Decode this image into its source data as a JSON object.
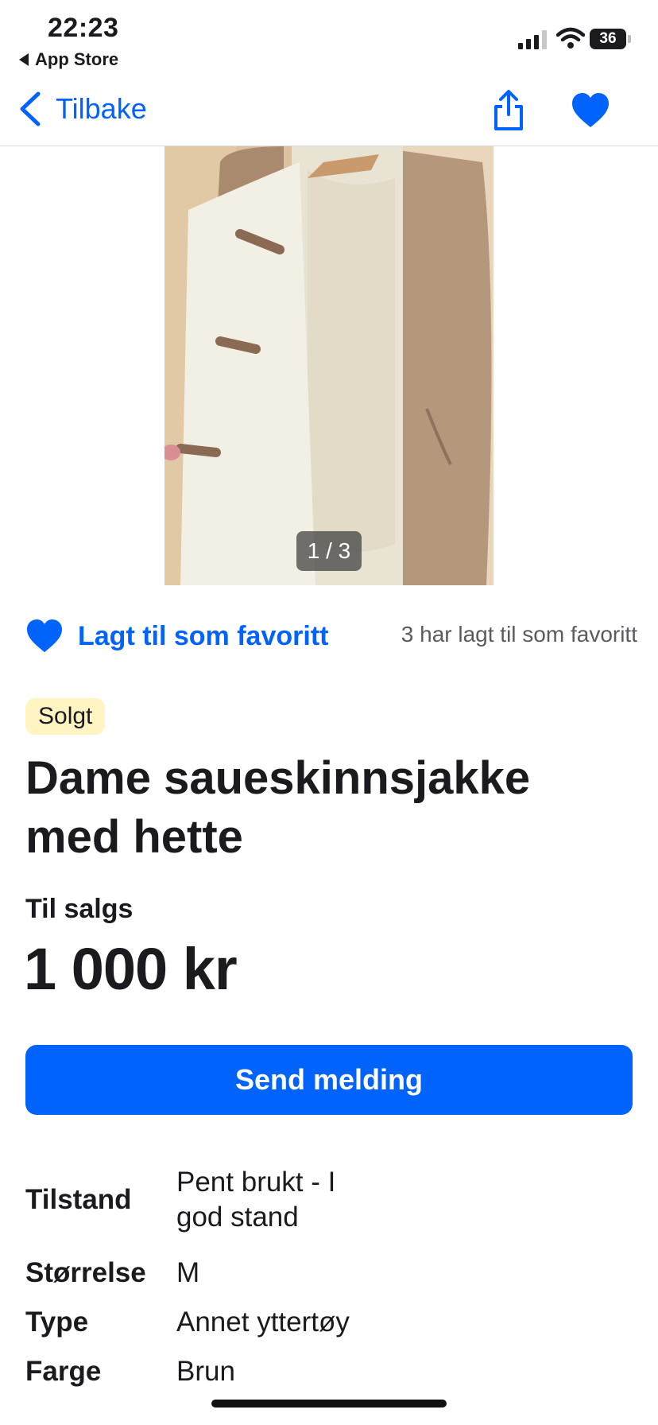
{
  "status_bar": {
    "time": "22:23",
    "back_app": "App Store",
    "battery": "36"
  },
  "nav": {
    "back_label": "Tilbake",
    "share_icon": "share-icon",
    "favorite_icon": "heart-icon"
  },
  "gallery": {
    "counter": "1 / 3"
  },
  "favorite": {
    "label": "Lagt til som favoritt",
    "count_text": "3 har lagt til som favoritt"
  },
  "listing": {
    "status_badge": "Solgt",
    "title": "Dame saueskinnsjakke med hette",
    "sale_type": "Til salgs",
    "price": "1 000 kr",
    "send_button": "Send melding"
  },
  "specs": [
    {
      "key": "Tilstand",
      "value": "Pent brukt - I god stand"
    },
    {
      "key": "Størrelse",
      "value": "M"
    },
    {
      "key": "Type",
      "value": "Annet yttertøy"
    },
    {
      "key": "Farge",
      "value": "Brun"
    }
  ],
  "colors": {
    "accent": "#0063fb",
    "badge_bg": "#fff4c2",
    "text": "#1b1b1f"
  }
}
